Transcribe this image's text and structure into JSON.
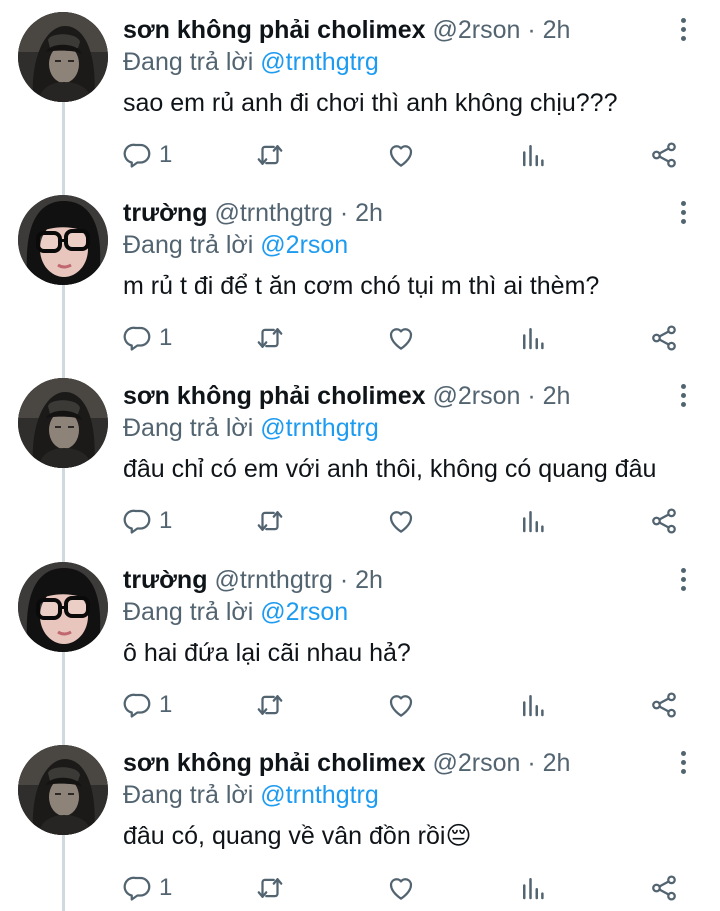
{
  "colors": {
    "accent": "#1d9bf0",
    "secondary": "#536471",
    "thread_line": "#cfd9de"
  },
  "tweets": [
    {
      "name": "sơn không phải cholimex",
      "handle": "@2rson",
      "dot": "·",
      "time": "2h",
      "replying_prefix": "Đang trả lời",
      "replying_to": "@trnthgtrg",
      "text": "sao em rủ anh đi chơi thì anh không chịu???",
      "reply_count": "1",
      "avatar": "avatar-hooded-man"
    },
    {
      "name": "trường",
      "handle": "@trnthgtrg",
      "dot": "·",
      "time": "2h",
      "replying_prefix": "Đang trả lời",
      "replying_to": "@2rson",
      "text": "m rủ t đi để t ăn cơm chó tụi m thì ai thèm?",
      "reply_count": "1",
      "avatar": "avatar-glasses-woman"
    },
    {
      "name": "sơn không phải cholimex",
      "handle": "@2rson",
      "dot": "·",
      "time": "2h",
      "replying_prefix": "Đang trả lời",
      "replying_to": "@trnthgtrg",
      "text": "đâu chỉ có em với anh thôi, không có quang đâu",
      "reply_count": "1",
      "avatar": "avatar-hooded-man"
    },
    {
      "name": "trường",
      "handle": "@trnthgtrg",
      "dot": "·",
      "time": "2h",
      "replying_prefix": "Đang trả lời",
      "replying_to": "@2rson",
      "text": "ô hai đứa lại cãi nhau hả?",
      "reply_count": "1",
      "avatar": "avatar-glasses-woman"
    },
    {
      "name": "sơn không phải cholimex",
      "handle": "@2rson",
      "dot": "·",
      "time": "2h",
      "replying_prefix": "Đang trả lời",
      "replying_to": "@trnthgtrg",
      "text": "đâu có, quang về vân đồn rồi😔",
      "reply_count": "1",
      "avatar": "avatar-hooded-man"
    }
  ]
}
